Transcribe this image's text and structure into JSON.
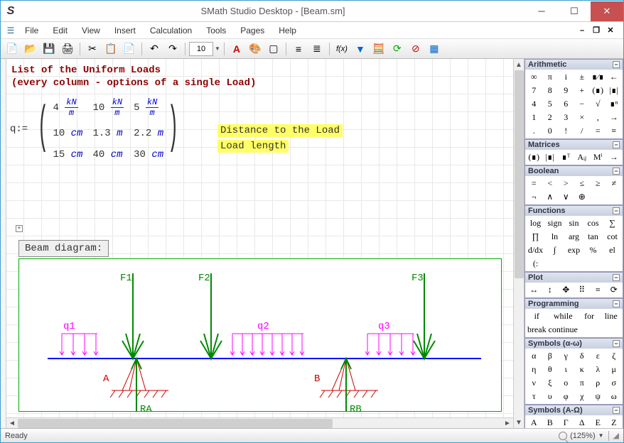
{
  "window": {
    "title": "SMath Studio Desktop - [Beam.sm]"
  },
  "menu": {
    "file": "File",
    "edit": "Edit",
    "view": "View",
    "insert": "Insert",
    "calculation": "Calculation",
    "tools": "Tools",
    "pages": "Pages",
    "help": "Help"
  },
  "toolbar": {
    "font_size": "10"
  },
  "sheet": {
    "heading1": "List of the Uniform Loads",
    "heading2": "(every column - options of a single Load)",
    "expand_handle": "+",
    "matrix_var": "q",
    "assign": ":=",
    "note1": "Distance to the Load",
    "note2": "Load length",
    "diagram_label": "Beam diagram:",
    "matrix": {
      "row1": [
        {
          "val": "4",
          "unit_num": "kN",
          "unit_den": "m"
        },
        {
          "val": "10",
          "unit_num": "kN",
          "unit_den": "m"
        },
        {
          "val": "5",
          "unit_num": "kN",
          "unit_den": "m"
        }
      ],
      "row2": [
        {
          "val": "10",
          "unit": "cm"
        },
        {
          "val": "1.3",
          "unit": "m"
        },
        {
          "val": "2.2",
          "unit": "m"
        }
      ],
      "row3": [
        {
          "val": "15",
          "unit": "cm"
        },
        {
          "val": "40",
          "unit": "cm"
        },
        {
          "val": "30",
          "unit": "cm"
        }
      ]
    }
  },
  "diagram": {
    "forces": [
      "F1",
      "F2",
      "F3"
    ],
    "loads": [
      "q1",
      "q2",
      "q3"
    ],
    "supports": [
      "A",
      "B"
    ],
    "reactions": [
      "RA",
      "RB"
    ]
  },
  "palettes": {
    "arithmetic": {
      "title": "Arithmetic",
      "items": [
        "∞",
        "π",
        "i",
        "±",
        "∎⁄∎",
        "←",
        "7",
        "8",
        "9",
        "+",
        "(∎)",
        "|∎|",
        "4",
        "5",
        "6",
        "−",
        "√",
        "∎ⁿ",
        "1",
        "2",
        "3",
        "×",
        ",",
        "→",
        ".",
        "0",
        "!",
        "/",
        "=",
        "≡"
      ]
    },
    "matrices": {
      "title": "Matrices",
      "items": [
        "(∎)",
        "|∎|",
        "∎ᵀ",
        "Aᵢⱼ",
        "Mⁱ",
        "→"
      ]
    },
    "boolean": {
      "title": "Boolean",
      "items": [
        "=",
        "<",
        ">",
        "≤",
        "≥",
        "≠",
        "¬",
        "∧",
        "∨",
        "⊕",
        "",
        ""
      ]
    },
    "functions": {
      "title": "Functions",
      "items": [
        "log",
        "sign",
        "sin",
        "cos",
        "∑",
        "∏",
        "ln",
        "arg",
        "tan",
        "cot",
        "d/dx",
        "∫",
        "exp",
        "%",
        "el",
        "(:",
        "",
        ""
      ]
    },
    "plot": {
      "title": "Plot",
      "items": [
        "↔",
        "↕",
        "✥",
        "⠿",
        "≡",
        "⟳"
      ]
    },
    "programming": {
      "title": "Programming",
      "items": [
        "if",
        "while",
        "for",
        "line",
        "break",
        "continue",
        "",
        ""
      ]
    },
    "symbols_lower": {
      "title": "Symbols (α-ω)",
      "items": [
        "α",
        "β",
        "γ",
        "δ",
        "ε",
        "ζ",
        "η",
        "θ",
        "ι",
        "κ",
        "λ",
        "μ",
        "ν",
        "ξ",
        "ο",
        "π",
        "ρ",
        "σ",
        "τ",
        "υ",
        "φ",
        "χ",
        "ψ",
        "ω"
      ]
    },
    "symbols_upper": {
      "title": "Symbols (Α-Ω)",
      "items": [
        "Α",
        "Β",
        "Γ",
        "Δ",
        "Ε",
        "Ζ"
      ]
    }
  },
  "statusbar": {
    "ready": "Ready",
    "zoom": "(125%)"
  }
}
